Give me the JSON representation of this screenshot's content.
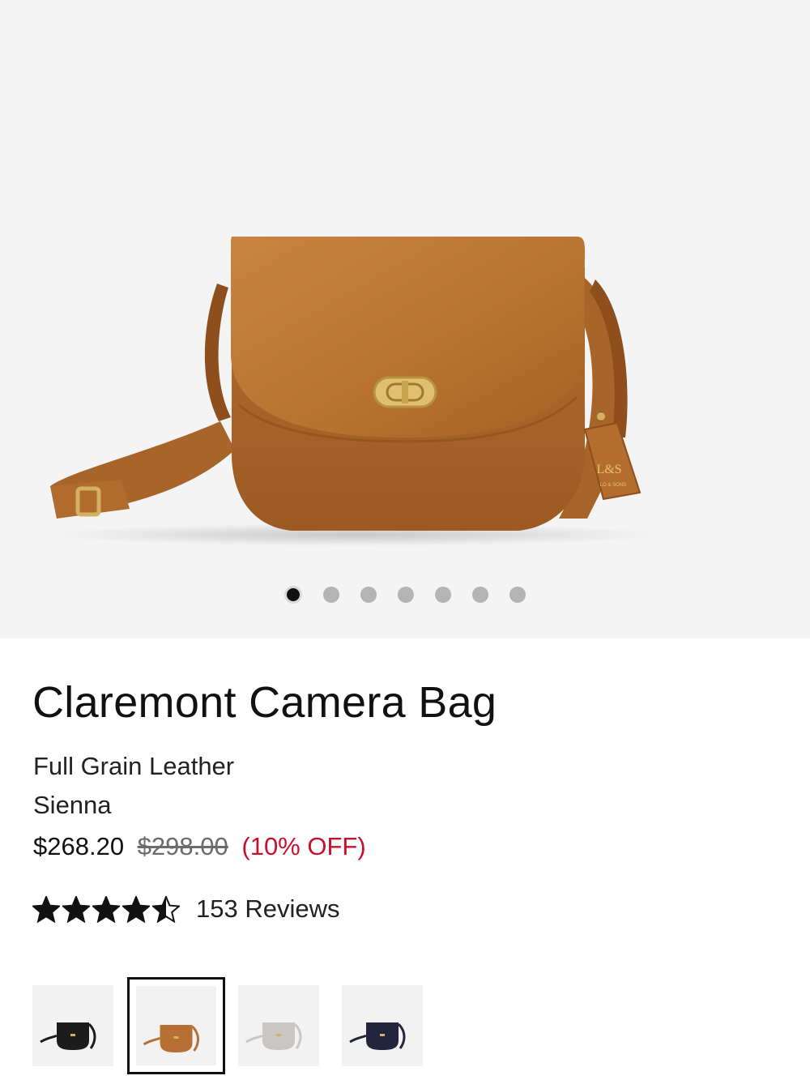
{
  "product": {
    "title": "Claremont Camera Bag",
    "material": "Full Grain Leather",
    "color": "Sienna",
    "price": "$268.20",
    "original_price": "$298.00",
    "discount": "(10% OFF)",
    "rating": 4.5,
    "reviews": "153 Reviews",
    "tag_monogram": "L&S",
    "tag_text": "LO & SONS"
  },
  "gallery": {
    "slide_count": 7,
    "active_slide": 1
  },
  "colors": {
    "accent_sale": "#c8102e",
    "bag_sienna": "#b86f33",
    "hardware_gold": "#d4b162"
  },
  "swatches": [
    {
      "name": "black-swatch",
      "color": "#1c1c1c",
      "selected": false
    },
    {
      "name": "sienna-swatch",
      "color": "#b86f33",
      "selected": true
    },
    {
      "name": "grey-swatch",
      "color": "#c9c6c4",
      "selected": false
    },
    {
      "name": "navy-swatch",
      "color": "#23253f",
      "selected": false
    }
  ]
}
